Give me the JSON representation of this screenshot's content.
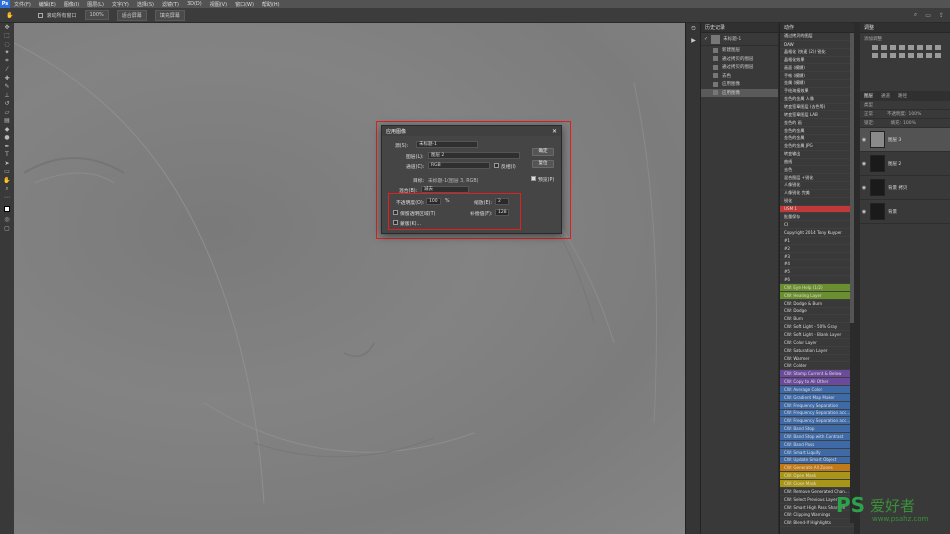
{
  "menu": [
    "文件(F)",
    "编辑(E)",
    "图像(I)",
    "图层(L)",
    "文字(Y)",
    "选择(S)",
    "滤镜(T)",
    "3D(D)",
    "视图(V)",
    "窗口(W)",
    "帮助(H)"
  ],
  "optbar": {
    "check_label": "滚动所有窗口",
    "zoom": "100%",
    "fit_btn": "适合屏幕",
    "fill_btn": "填充屏幕"
  },
  "history": {
    "title": "历史记录",
    "snapshot": "未标题-1",
    "items": [
      "新建图层",
      "通过拷贝的图层",
      "通过拷贝的图层",
      "去色",
      "应用图像",
      "应用图像"
    ]
  },
  "actions": {
    "title": "动作",
    "items": [
      {
        "label": "通过拷贝的图层",
        "color": ""
      },
      {
        "label": "DAW",
        "color": ""
      },
      {
        "label": "晶格化 (快速 (2)) 锐化",
        "color": ""
      },
      {
        "label": "晶格化效果",
        "color": ""
      },
      {
        "label": "画面 (模糊)",
        "color": ""
      },
      {
        "label": "手帐 (模糊)",
        "color": ""
      },
      {
        "label": "金属 (模糊)",
        "color": ""
      },
      {
        "label": "手绘海报效果",
        "color": ""
      },
      {
        "label": "金色的金属 人像",
        "color": ""
      },
      {
        "label": "转变签章图层 (去色等)",
        "color": ""
      },
      {
        "label": "转变签章图层 LAB",
        "color": ""
      },
      {
        "label": "金色的 画",
        "color": ""
      },
      {
        "label": "金色的金属",
        "color": ""
      },
      {
        "label": "金色的金属",
        "color": ""
      },
      {
        "label": "金色的金属 JPG",
        "color": ""
      },
      {
        "label": "转变输出",
        "color": ""
      },
      {
        "label": "曲线",
        "color": ""
      },
      {
        "label": "去色",
        "color": ""
      },
      {
        "label": "混合图层 +锐化",
        "color": ""
      },
      {
        "label": "人像锐化",
        "color": ""
      },
      {
        "label": "人像锐化 完美",
        "color": ""
      },
      {
        "label": "锐化",
        "color": ""
      },
      {
        "label": "USM 1",
        "color": "#c13838"
      },
      {
        "label": "批量保存",
        "color": ""
      },
      {
        "label": "CI",
        "color": ""
      },
      {
        "label": "Copyright 2014 Tony Kuyper",
        "color": ""
      },
      {
        "label": "#1",
        "color": ""
      },
      {
        "label": "#2",
        "color": ""
      },
      {
        "label": "#3",
        "color": ""
      },
      {
        "label": "#4",
        "color": ""
      },
      {
        "label": "#5",
        "color": ""
      },
      {
        "label": "#6",
        "color": ""
      },
      {
        "label": "CW: Eye Help (1/2)",
        "color": "#6a8f2e"
      },
      {
        "label": "CW: Healing Layer",
        "color": "#6a8f2e"
      },
      {
        "label": "CW: Dodge & Burn",
        "color": ""
      },
      {
        "label": "CW: Dodge",
        "color": ""
      },
      {
        "label": "CW: Burn",
        "color": ""
      },
      {
        "label": "CW: Soft Light - 50% Gray",
        "color": ""
      },
      {
        "label": "CW: Soft Light - Blank Layer",
        "color": ""
      },
      {
        "label": "CW: Color Layer",
        "color": ""
      },
      {
        "label": "CW: Saturation Layer",
        "color": ""
      },
      {
        "label": "CW: Warmer",
        "color": ""
      },
      {
        "label": "CW: Colder",
        "color": ""
      },
      {
        "label": "CW: Stamp Current & Below",
        "color": "#6b4a9c"
      },
      {
        "label": "CW: Copy to All Other",
        "color": "#6b4a9c"
      },
      {
        "label": "CW: Average Color",
        "color": "#3f6aa8"
      },
      {
        "label": "CW: Gradient Map Maker",
        "color": "#3f6aa8"
      },
      {
        "label": "CW: Frequency Separation",
        "color": "#3f6aa8"
      },
      {
        "label": "CW: Frequency Separation acc...",
        "color": "#3f6aa8"
      },
      {
        "label": "CW: Frequency Separation acc...",
        "color": "#3f6aa8"
      },
      {
        "label": "CW: Band Stop",
        "color": "#3f6aa8"
      },
      {
        "label": "CW: Band Stop with Contrast",
        "color": "#3f6aa8"
      },
      {
        "label": "CW: Band Pass",
        "color": "#3f6aa8"
      },
      {
        "label": "CW: Smart Liquify",
        "color": "#3f6aa8"
      },
      {
        "label": "CW: Update Smart Object",
        "color": "#3f6aa8"
      },
      {
        "label": "CW: Generate All Zones",
        "color": "#c17a16"
      },
      {
        "label": "CW: Open Mask",
        "color": "#a99517"
      },
      {
        "label": "CW: Close Mask",
        "color": "#a99517"
      },
      {
        "label": "CW: Remove Generated Chan...",
        "color": ""
      },
      {
        "label": "CW: Select Previous Layer",
        "color": ""
      },
      {
        "label": "CW: Smart High Pass Sharpen",
        "color": ""
      },
      {
        "label": "CW: Clipping Warnings",
        "color": ""
      },
      {
        "label": "CW: Blend-If Highlights",
        "color": ""
      }
    ]
  },
  "adjust": {
    "title": "调整",
    "subtitle": "添加调整"
  },
  "layers": {
    "tabs": [
      "图层",
      "通道",
      "路径"
    ],
    "kind": "类型",
    "blend": "正常",
    "opacity_label": "不透明度:",
    "opacity": "100%",
    "fill_label": "填充:",
    "fill": "100%",
    "lock_label": "锁定:",
    "items": [
      {
        "name": "图层 3",
        "selected": true
      },
      {
        "name": "图层 2",
        "selected": false
      },
      {
        "name": "背景 拷贝",
        "selected": false
      },
      {
        "name": "背景",
        "selected": false
      }
    ]
  },
  "dialog": {
    "title": "应用图像",
    "source_label": "源(S):",
    "source": "未标题-1",
    "layer_label": "图层(L):",
    "layer": "图层 2",
    "channel_label": "通道(C):",
    "channel": "RGB",
    "invert_label": "反相(I)",
    "target_label": "目标:",
    "target": "未标题-1(图层 3, RGB)",
    "blend_label": "混合(B):",
    "blend": "减去",
    "opacity_label": "不透明度(O):",
    "opacity": "100",
    "opacity_unit": "%",
    "scale_label": "缩放(E):",
    "scale": "2",
    "preserve_label": "保留透明区域(T)",
    "offset_label": "补偿值(F):",
    "offset": "128",
    "mask_label": "蒙版(K)...",
    "ok": "确定",
    "cancel": "复位",
    "preview_label": "预览(P)"
  },
  "watermark": {
    "logo": "PS",
    "text": "爱好者",
    "url": "www.psahz.com"
  }
}
